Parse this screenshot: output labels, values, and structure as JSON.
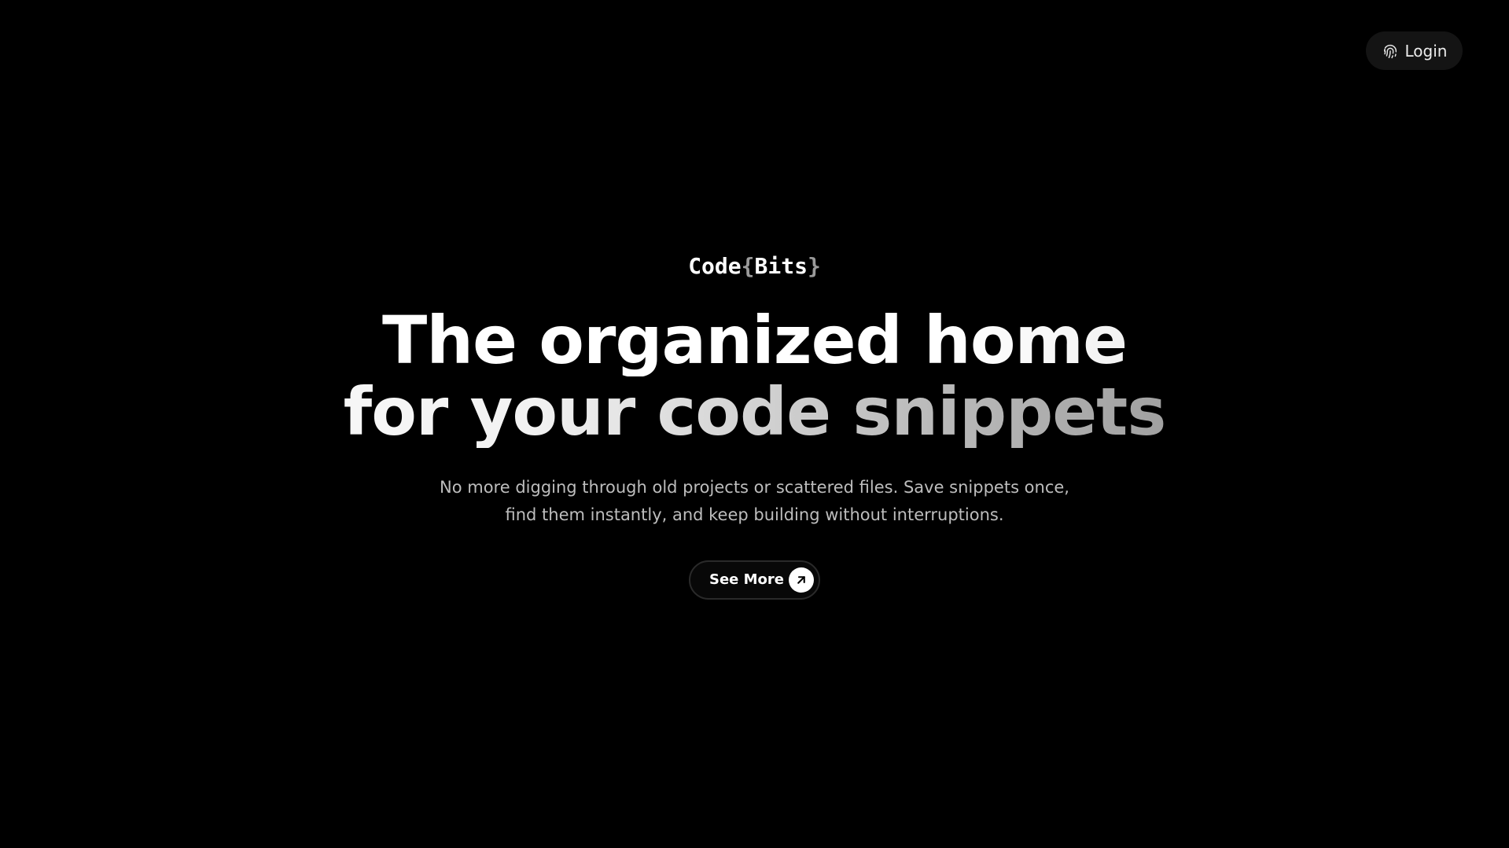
{
  "header": {
    "login_label": "Login",
    "login_icon": "fingerprint-icon"
  },
  "hero": {
    "brand": {
      "prefix": "Code",
      "open_brace": "{",
      "name": "Bits",
      "close_brace": "}"
    },
    "headline": {
      "line1": "The organized home",
      "line2": "for your code snippets"
    },
    "subtitle": {
      "line1": "No more digging through old projects or scattered files. Save snippets once,",
      "line2": "find them instantly, and keep building without interruptions."
    },
    "cta": {
      "label": "See More",
      "icon": "arrow-up-right-icon"
    }
  },
  "colors": {
    "background": "#000000",
    "text": "#ffffff",
    "muted_text": "#bdbdbd",
    "button_bg": "#141414"
  }
}
